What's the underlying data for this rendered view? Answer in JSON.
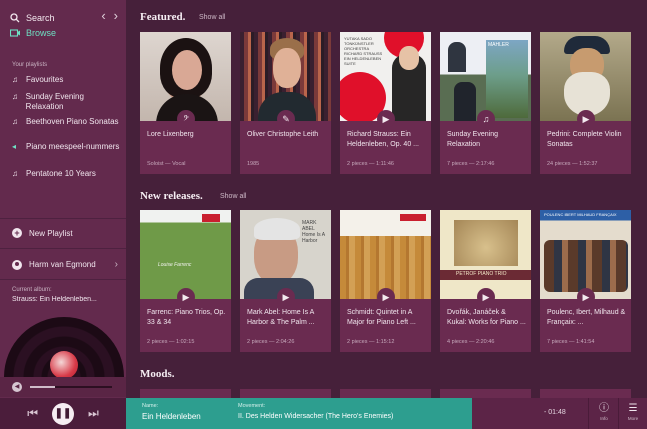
{
  "sidebar": {
    "search_label": "Search",
    "browse_label": "Browse",
    "playlists_caption": "Your playlists",
    "playlists": [
      {
        "label": "Favourites",
        "icon": "music-note-icon"
      },
      {
        "label": "Sunday Evening Relaxation",
        "icon": "music-note-icon"
      },
      {
        "label": "Beethoven Piano Sonatas",
        "icon": "music-note-icon"
      },
      {
        "label": "Piano meespeel-nummers",
        "icon": "speaker-icon"
      },
      {
        "label": "Pentatone 10 Years",
        "icon": "music-note-icon"
      }
    ],
    "new_playlist_label": "New Playlist",
    "user_name": "Harm van Egmond",
    "current_album_caption": "Current album:",
    "current_album_title": "Strauss: Ein Heldenleben..."
  },
  "featured": {
    "heading": "Featured.",
    "show_all": "Show all",
    "cards": [
      {
        "title": "Lore Lixenberg",
        "meta": "Soloist — Vocal",
        "badge_icon": "clef-icon"
      },
      {
        "title": "Oliver Christophe Leith",
        "meta": "1985",
        "badge_icon": "pencil-icon"
      },
      {
        "title": "Richard Strauss: Ein Heldenleben, Op. 40 ...",
        "meta": "2 pieces — 1:11:46",
        "badge_icon": "video-icon"
      },
      {
        "title": "Sunday Evening Relaxation",
        "meta": "7 pieces — 2:17:46",
        "badge_icon": "music-note-icon"
      },
      {
        "title": "Pedrini: Complete Violin Sonatas",
        "meta": "24 pieces — 1:52:37",
        "badge_icon": "video-icon"
      }
    ],
    "art_text": {
      "c3": "YUTAKA SADO TONKÜNSTLER ORCHESTRA RICHARD STRAUSS EIN HELDENLEBEN SUITE",
      "c4": "MAHLER"
    }
  },
  "new_releases": {
    "heading": "New releases.",
    "show_all": "Show all",
    "cards": [
      {
        "title": "Farrenc: Piano Trios, Op. 33 & 34",
        "meta": "2 pieces — 1:02:15",
        "badge_icon": "video-icon"
      },
      {
        "title": "Mark Abel: Home Is A Harbor & The Palm ...",
        "meta": "2 pieces — 2:04:26",
        "badge_icon": "video-icon"
      },
      {
        "title": "Schmidt: Quintet in A Major for Piano Left ...",
        "meta": "2 pieces — 1:15:12",
        "badge_icon": "video-icon"
      },
      {
        "title": "Dvořák, Janáček & Kukal: Works for Piano ...",
        "meta": "4 pieces — 2:20:46",
        "badge_icon": "video-icon"
      },
      {
        "title": "Poulenc, Ibert, Milhaud & Françaix: ...",
        "meta": "7 pieces — 1:41:54",
        "badge_icon": "video-icon"
      }
    ],
    "art_text": {
      "c1": "Louise Farrenc",
      "c2": "MARK ABEL Home Is A Harbor",
      "c4": "PETROF PIANO TRIO",
      "c5": "POULENC IBERT MILHAUD FRANÇAIX"
    }
  },
  "moods": {
    "heading": "Moods."
  },
  "player": {
    "name_caption": "Name:",
    "name_value": "Ein Heldenleben",
    "movement_caption": "Movement:",
    "movement_value": "II. Des Helden Widersacher (The Hero's Enemies)",
    "time": "- 01:48",
    "info_label": "Info",
    "more_label": "More",
    "volume_level": 0.3,
    "accent_color": "#2d9e8f"
  }
}
